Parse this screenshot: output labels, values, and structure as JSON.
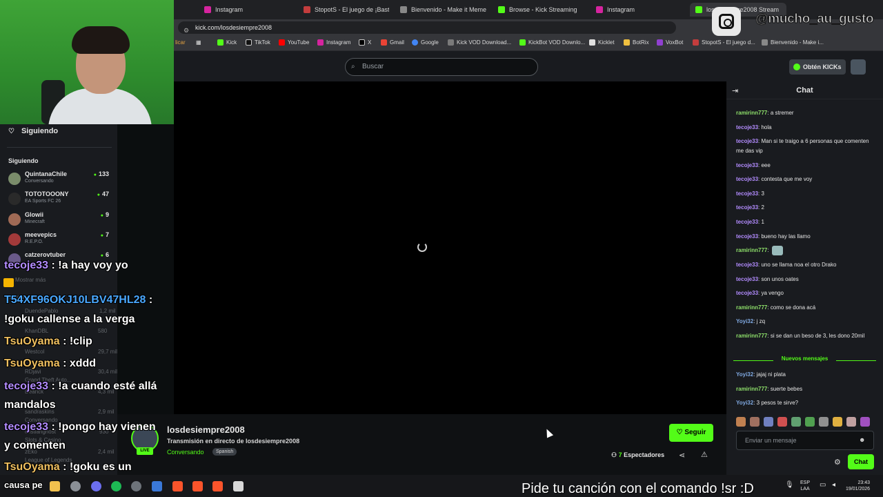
{
  "browser": {
    "tabs": [
      {
        "label": "Instagram",
        "color": "#d6249f"
      },
      {
        "label": "StopotS - El juego de ¡Basta!, p",
        "color": "#c33d3d"
      },
      {
        "label": "Bienvenido - Make it Meme",
        "color": "#888888"
      },
      {
        "label": "Browse - Kick Streaming",
        "color": "#53fc18"
      },
      {
        "label": "Instagram",
        "color": "#d6249f"
      },
      {
        "label": "losdesiempre2008 Stream",
        "color": "#53fc18"
      }
    ],
    "url": "kick.com/losdesiempre2008",
    "bookmarks": [
      "licar",
      "Kick",
      "TikTok",
      "YouTube",
      "Instagram",
      "X",
      "Gmail",
      "Google",
      "Kick VOD Download...",
      "KickBot VOD Downlo...",
      "Kicklet",
      "BotRix",
      "VoxBot",
      "StopotS - El juego d...",
      "Bienvenido - Make i..."
    ]
  },
  "header": {
    "search_placeholder": "Buscar",
    "kicks_label": "Obtén KICKs"
  },
  "sidebar": {
    "following_nav": "Siguiendo",
    "following_heading": "Siguiendo",
    "channels": [
      {
        "name": "QuintanaChile",
        "game": "Conversando",
        "viewers": "133",
        "color": "#7a8c6a"
      },
      {
        "name": "TOTOTOOONY",
        "game": "EA Sports FC 26",
        "viewers": "47",
        "color": "#2a2a2a"
      },
      {
        "name": "Glowii",
        "game": "Minecraft",
        "viewers": "9",
        "color": "#a06a55"
      },
      {
        "name": "meevepics",
        "game": "R.E.P.O.",
        "viewers": "7",
        "color": "#a33a3a"
      },
      {
        "name": "catzerovtuber",
        "game": "",
        "viewers": "6",
        "color": "#6a5a8a"
      }
    ]
  },
  "player": {
    "stream_name": "losdesiempre2008",
    "stream_title": "Transmisión en directo de losdesiempre2008",
    "category": "Conversando",
    "language": "Spanish",
    "live_label": "LIVE",
    "follow_label": "Seguir",
    "viewers_count": "7",
    "viewers_label": "Espectadores"
  },
  "chat": {
    "title": "Chat",
    "messages": [
      {
        "user": "ramirinn777",
        "text": "a stremer",
        "color": "#8ee06a"
      },
      {
        "user": "tecoje33",
        "text": "hola",
        "color": "#b38cff"
      },
      {
        "user": "tecoje33",
        "text": "Man si te traigo a 6 personas que comenten me das vip",
        "color": "#b38cff"
      },
      {
        "user": "tecoje33",
        "text": "eee",
        "color": "#b38cff"
      },
      {
        "user": "tecoje33",
        "text": "contesta que me voy",
        "color": "#b38cff"
      },
      {
        "user": "tecoje33",
        "text": "3",
        "color": "#b38cff"
      },
      {
        "user": "tecoje33",
        "text": "2",
        "color": "#b38cff"
      },
      {
        "user": "tecoje33",
        "text": "1",
        "color": "#b38cff"
      },
      {
        "user": "tecoje33",
        "text": "bueno hay las llamo",
        "color": "#b38cff"
      },
      {
        "user": "ramirinn777",
        "text": "",
        "color": "#8ee06a"
      },
      {
        "user": "tecoje33",
        "text": "uno se llama noa el otro Drako",
        "color": "#b38cff"
      },
      {
        "user": "tecoje33",
        "text": "son unos oates",
        "color": "#b38cff"
      },
      {
        "user": "tecoje33",
        "text": "ya vengo",
        "color": "#b38cff"
      },
      {
        "user": "ramirinn777",
        "text": "como se dona acá",
        "color": "#8ee06a"
      },
      {
        "user": "Yoyi32",
        "text": "j zq",
        "color": "#7fa8e0"
      },
      {
        "user": "ramirinn777",
        "text": "si se dan un beso de 3, les dono 20mil",
        "color": "#8ee06a"
      }
    ],
    "new_messages_label": "Nuevos mensajes",
    "new_messages": [
      {
        "user": "Yoyi32",
        "text": "jajaj ni plata",
        "color": "#7fa8e0"
      },
      {
        "user": "ramirinn777",
        "text": "suerte bebes",
        "color": "#8ee06a"
      },
      {
        "user": "Yoyi32",
        "text": "3 pesos te sirve?",
        "color": "#7fa8e0"
      }
    ],
    "input_placeholder": "Enviar un mensaje",
    "send_label": "Chat"
  },
  "overlay": {
    "instagram_handle": "@mucho_au_gusto",
    "song_request": "Pide tu canción con el comando !sr :D",
    "stream_chat": [
      {
        "user": "tecoje33",
        "text": " : !a hay voy yo",
        "color": "#b38cff"
      },
      {
        "user": "T54XF96OKJ10LBV47HL28",
        "text": " :",
        "color": "#4aa8ff"
      },
      {
        "user": "",
        "text": "!goku callense a la verga",
        "color": "#ffffff"
      },
      {
        "user": "TsuOyama",
        "text": " : !clip",
        "color": "#f0c060"
      },
      {
        "user": "TsuOyama",
        "text": " : xddd",
        "color": "#f0c060"
      },
      {
        "user": "tecoje33",
        "text": " : !a cuando esté allá",
        "color": "#b38cff"
      },
      {
        "user": "",
        "text": "mandalos",
        "color": "#ffffff"
      },
      {
        "user": "tecoje33",
        "text": " : !pongo hay vienen",
        "color": "#b38cff"
      },
      {
        "user": "",
        "text": "y comenten",
        "color": "#ffffff"
      },
      {
        "user": "TsuOyama",
        "text": " : !goku es un",
        "color": "#f0c060"
      },
      {
        "user": "",
        "text": "causa pe",
        "color": "#ffffff"
      }
    ],
    "ghost_text": [
      "Mostrar más",
      "Recomendados",
      "DuendePablo",
      "1,2 mil",
      "KhanDBL",
      "580",
      "Westcol",
      "29,7 mil",
      "RDjavi",
      "30,4 mil",
      "Grand Theft Auto...",
      "Dearick",
      "4,3 mil",
      "sandraskins",
      "2,9 mil",
      "Conversando",
      "cristiangnost",
      "930",
      "Slots & Casino",
      "zEko",
      "2,4 mil",
      "League of Legends"
    ]
  },
  "taskbar": {
    "lang_top": "ESP",
    "lang_bottom": "LAA",
    "time": "23:43",
    "date": "19/01/2026"
  }
}
